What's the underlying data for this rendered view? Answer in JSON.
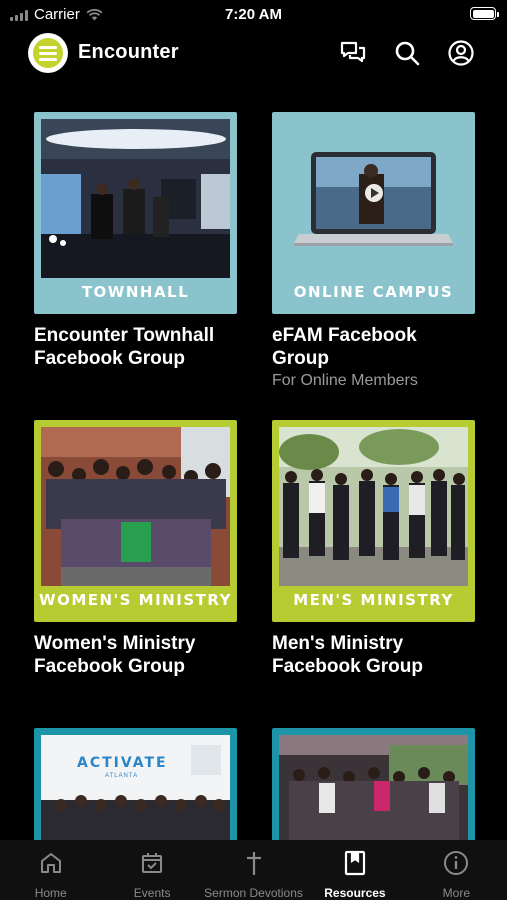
{
  "status_bar": {
    "carrier": "Carrier",
    "time": "7:20 AM"
  },
  "header": {
    "title": "Encounter",
    "icons": [
      "chat-icon",
      "search-icon",
      "account-icon"
    ]
  },
  "colors": {
    "accent_lime": "#b6cc32",
    "accent_teal": "#8bc3cc",
    "background": "#000000"
  },
  "cards": [
    {
      "thumb_label": "TOWNHALL",
      "title": "Encounter Townhall Facebook Group",
      "subtitle": ""
    },
    {
      "thumb_label": "ONLINE CAMPUS",
      "title": "eFAM Facebook Group",
      "subtitle": "For Online Members"
    },
    {
      "thumb_label": "WOMEN'S MINISTRY",
      "title": "Women's Ministry Facebook Group",
      "subtitle": ""
    },
    {
      "thumb_label": "MEN'S MINISTRY",
      "title": "Men's Ministry Facebook Group",
      "subtitle": ""
    },
    {
      "thumb_label": "ACTIVATE",
      "thumb_sublabel": "ATLANTA",
      "title": "",
      "subtitle": ""
    },
    {
      "thumb_label": "",
      "title": "",
      "subtitle": ""
    }
  ],
  "tab_bar": {
    "items": [
      {
        "label": "Home",
        "icon": "home-icon"
      },
      {
        "label": "Events",
        "icon": "calendar-icon"
      },
      {
        "label": "Sermon Devotions",
        "icon": "cross-icon"
      },
      {
        "label": "Resources",
        "icon": "book-icon"
      },
      {
        "label": "More",
        "icon": "info-icon"
      }
    ],
    "active": "Resources"
  }
}
